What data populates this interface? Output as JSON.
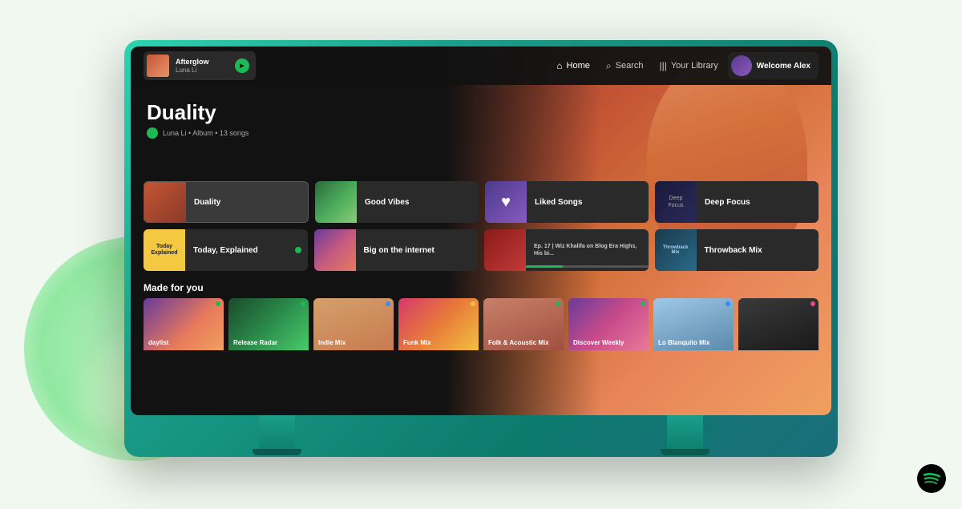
{
  "page": {
    "background": "#f0f8f0"
  },
  "navbar": {
    "now_playing": {
      "title": "Afterglow",
      "artist": "Luna Li"
    },
    "nav_links": [
      {
        "label": "Home",
        "icon": "🏠",
        "active": true
      },
      {
        "label": "Search",
        "icon": "🔍",
        "active": false
      },
      {
        "label": "Your Library",
        "icon": "|||",
        "active": false
      }
    ],
    "welcome_text": "Welcome Alex"
  },
  "hero": {
    "album_title": "Duality",
    "artist_name": "Luna Li",
    "album_type": "Album",
    "song_count": "13 songs"
  },
  "grid": {
    "row1": [
      {
        "label": "Duality",
        "type": "duality",
        "active": true
      },
      {
        "label": "Good Vibes",
        "type": "goodvibes",
        "active": false
      },
      {
        "label": "Liked Songs",
        "type": "liked",
        "active": false
      },
      {
        "label": "Deep Focus",
        "type": "deepfocus",
        "active": false
      }
    ],
    "row2": [
      {
        "label": "Today, Explained",
        "type": "todayexp",
        "active": false,
        "dot": true
      },
      {
        "label": "Big on the internet",
        "type": "biginternet",
        "active": false
      },
      {
        "label": "Ep. 17 | Wiz Khalifa on Blog Era Highs, His bi...",
        "type": "ep17",
        "active": false,
        "progress": true
      },
      {
        "label": "Throwback Mix",
        "type": "throwback",
        "active": false
      }
    ]
  },
  "made_for_you": {
    "title": "Made for you",
    "cards": [
      {
        "label": "daylist",
        "bg": "c1",
        "dot": "c-dot-green"
      },
      {
        "label": "Release\nRadar",
        "bg": "c2",
        "dot": "c-dot-green"
      },
      {
        "label": "Indie Mix",
        "bg": "c3",
        "dot": "c-dot-blue"
      },
      {
        "label": "Funk Mix",
        "bg": "c4",
        "dot": "c-dot-yellow"
      },
      {
        "label": "Folk & Acoustic Mix",
        "bg": "c5",
        "dot": "c-dot-green"
      },
      {
        "label": "Discover Weekly",
        "bg": "c6",
        "dot": "c-dot-green"
      },
      {
        "label": "Lo Blanquito Mix",
        "bg": "c7",
        "dot": "c-dot-blue"
      },
      {
        "label": "...",
        "bg": "c8",
        "dot": "c-dot-pink"
      }
    ]
  },
  "deep_focus_label": "Deep\nFocus",
  "throwback_inner_label": "Throwback\nMix",
  "today_exp_label": "Today\nExplained",
  "ep17_short": "Ep.17",
  "liked_heart": "♥"
}
